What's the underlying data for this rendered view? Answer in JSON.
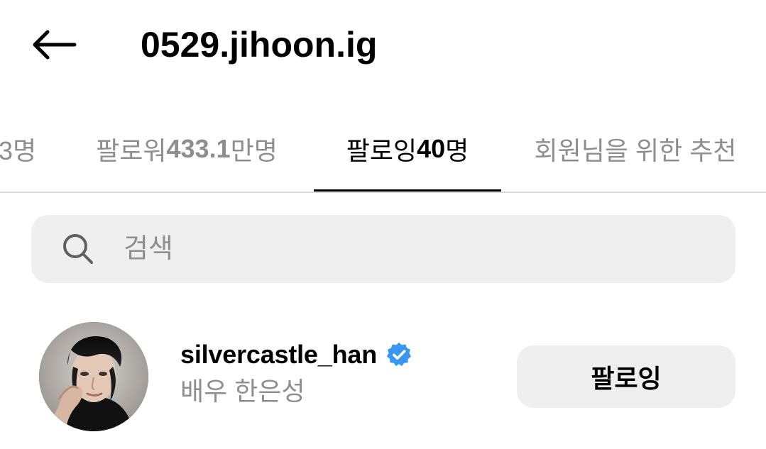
{
  "header": {
    "back_icon": "arrow-left-icon",
    "title": "0529.jihoon.ig"
  },
  "tabs": [
    {
      "label": "",
      "count": "3명",
      "active": false
    },
    {
      "label": "팔로워 ",
      "count": "433.1",
      "suffix": "만명",
      "active": false
    },
    {
      "label": "팔로잉 ",
      "count": "40",
      "suffix": "명",
      "active": true
    },
    {
      "label": "회원님을 위한 추천",
      "count": "",
      "suffix": "",
      "active": false
    }
  ],
  "search": {
    "icon": "search-icon",
    "placeholder": "검색",
    "value": ""
  },
  "users": [
    {
      "username": "silvercastle_han",
      "verified": true,
      "display_name": "배우 한은성",
      "button_label": "팔로잉"
    }
  ],
  "colors": {
    "accent": "#000000",
    "muted_text": "#8e8e8e",
    "verified_blue": "#3897f0",
    "button_bg": "#efefef"
  }
}
